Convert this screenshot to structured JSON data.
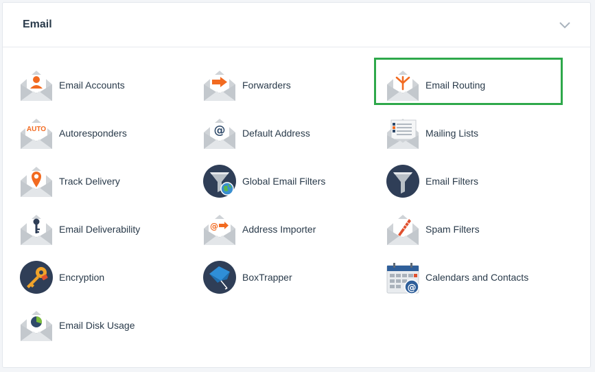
{
  "panel": {
    "title": "Email",
    "collapse_icon": "chevron-down-icon"
  },
  "items": [
    {
      "label": "Email Accounts",
      "icon": "email-accounts-icon"
    },
    {
      "label": "Forwarders",
      "icon": "forwarders-icon"
    },
    {
      "label": "Email Routing",
      "icon": "email-routing-icon",
      "highlighted": true
    },
    {
      "label": "Autoresponders",
      "icon": "autoresponders-icon"
    },
    {
      "label": "Default Address",
      "icon": "default-address-icon"
    },
    {
      "label": "Mailing Lists",
      "icon": "mailing-lists-icon"
    },
    {
      "label": "Track Delivery",
      "icon": "track-delivery-icon"
    },
    {
      "label": "Global Email Filters",
      "icon": "global-email-filters-icon"
    },
    {
      "label": "Email Filters",
      "icon": "email-filters-icon"
    },
    {
      "label": "Email Deliverability",
      "icon": "email-deliverability-icon"
    },
    {
      "label": "Address Importer",
      "icon": "address-importer-icon"
    },
    {
      "label": "Spam Filters",
      "icon": "spam-filters-icon"
    },
    {
      "label": "Encryption",
      "icon": "encryption-icon"
    },
    {
      "label": "BoxTrapper",
      "icon": "boxtrapper-icon"
    },
    {
      "label": "Calendars and Contacts",
      "icon": "calendars-and-contacts-icon"
    },
    {
      "label": "Email Disk Usage",
      "icon": "email-disk-usage-icon"
    }
  ],
  "icon_text": {
    "autoresponders": "AUTO"
  },
  "colors": {
    "accent_orange": "#f26a20",
    "navy": "#293a4a",
    "envelope": "#cfd3d7",
    "highlight_border": "#2ea84a"
  }
}
